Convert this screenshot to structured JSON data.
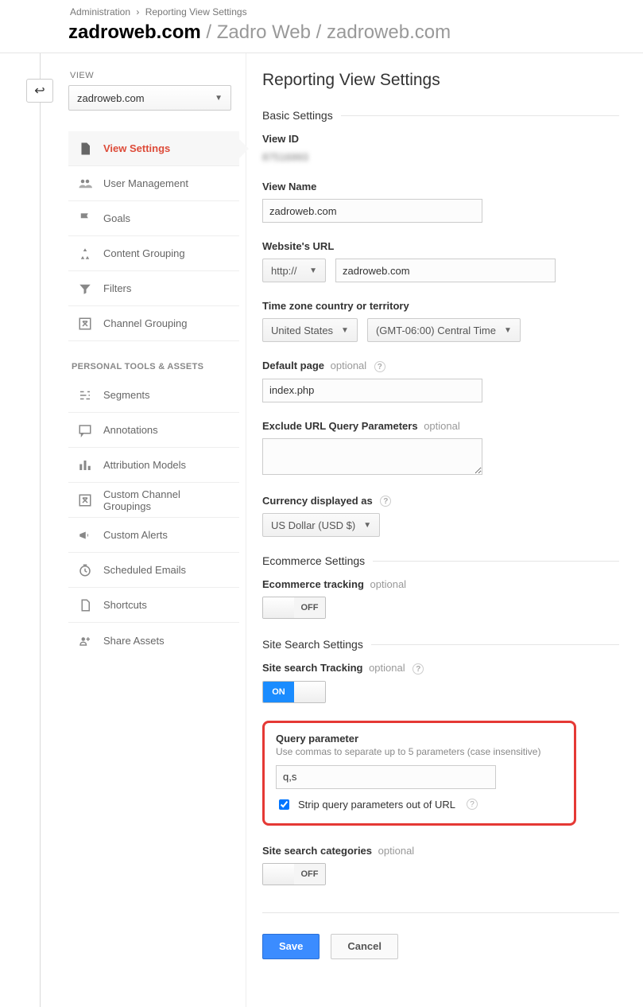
{
  "breadcrumb": {
    "admin": "Administration",
    "current": "Reporting View Settings"
  },
  "header": {
    "domain": "zadroweb.com",
    "account": "Zadro Web",
    "property": "zadroweb.com"
  },
  "back_glyph": "↩",
  "sidebar": {
    "view_label": "VIEW",
    "view_selected": "zadroweb.com",
    "items": [
      {
        "label": "View Settings"
      },
      {
        "label": "User Management"
      },
      {
        "label": "Goals"
      },
      {
        "label": "Content Grouping"
      },
      {
        "label": "Filters"
      },
      {
        "label": "Channel Grouping"
      }
    ],
    "tools_label": "PERSONAL TOOLS & ASSETS",
    "tools": [
      {
        "label": "Segments"
      },
      {
        "label": "Annotations"
      },
      {
        "label": "Attribution Models"
      },
      {
        "label": "Custom Channel Groupings"
      },
      {
        "label": "Custom Alerts"
      },
      {
        "label": "Scheduled Emails"
      },
      {
        "label": "Shortcuts"
      },
      {
        "label": "Share Assets"
      }
    ]
  },
  "page": {
    "title": "Reporting View Settings",
    "basic": "Basic Settings",
    "view_id_label": "View ID",
    "view_id_value": "87516993",
    "view_name_label": "View Name",
    "view_name_value": "zadroweb.com",
    "url_label": "Website's URL",
    "url_protocol": "http://",
    "url_value": "zadroweb.com",
    "tz_label": "Time zone country or territory",
    "tz_country": "United States",
    "tz_zone": "(GMT-06:00) Central Time",
    "default_page_label": "Default page",
    "optional": "optional",
    "default_page_value": "index.php",
    "exclude_label": "Exclude URL Query Parameters",
    "exclude_value": "",
    "currency_label": "Currency displayed as",
    "currency_value": "US Dollar (USD $)",
    "ecom_section": "Ecommerce Settings",
    "ecom_tracking_label": "Ecommerce tracking",
    "off": "OFF",
    "on": "ON",
    "search_section": "Site Search Settings",
    "search_tracking_label": "Site search Tracking",
    "qparam_label": "Query parameter",
    "qparam_hint": "Use commas to separate up to 5 parameters (case insensitive)",
    "qparam_value": "q,s",
    "strip_label": "Strip query parameters out of URL",
    "search_cat_label": "Site search categories",
    "save": "Save",
    "cancel": "Cancel",
    "help_glyph": "?"
  }
}
